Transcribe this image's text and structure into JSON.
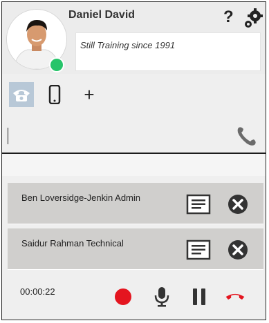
{
  "user": {
    "name": "Daniel David",
    "motto": "Still Training since 1991",
    "status": "online",
    "status_color": "#27c46a"
  },
  "header_icons": {
    "help_label": "?",
    "settings_icon": "settings-gear-icon"
  },
  "tabs": [
    {
      "name": "phone",
      "icon": "phone-handset-icon",
      "active": true
    },
    {
      "name": "mobile",
      "icon": "mobile-phone-icon",
      "active": false
    },
    {
      "name": "add",
      "label": "+",
      "active": false
    }
  ],
  "dial": {
    "value": "",
    "call_icon": "call-handset-icon"
  },
  "participants": [
    {
      "label": "Ben Loversidge-Jenkin Admin"
    },
    {
      "label": "Saidur Rahman Technical"
    }
  ],
  "call_controls": {
    "timer": "00:00:22",
    "record_color": "#e4151f",
    "hangup_color": "#e4151f"
  }
}
